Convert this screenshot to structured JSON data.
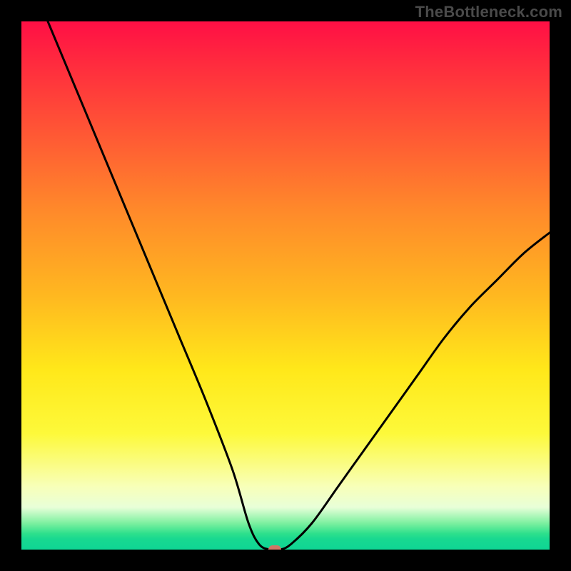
{
  "watermark": "TheBottleneck.com",
  "chart_data": {
    "type": "line",
    "title": "",
    "xlabel": "",
    "ylabel": "",
    "xlim": [
      0,
      100
    ],
    "ylim": [
      0,
      100
    ],
    "grid": false,
    "legend": false,
    "gradient_zones": [
      {
        "color": "#ff0f45",
        "position_pct": 0,
        "meaning": "severe-bottleneck"
      },
      {
        "color": "#ff8a2a",
        "position_pct": 36,
        "meaning": "high-bottleneck"
      },
      {
        "color": "#ffe81a",
        "position_pct": 66,
        "meaning": "moderate"
      },
      {
        "color": "#f8ffb8",
        "position_pct": 88,
        "meaning": "low"
      },
      {
        "color": "#18d890",
        "position_pct": 98,
        "meaning": "optimal"
      }
    ],
    "series": [
      {
        "name": "bottleneck-curve",
        "x": [
          5,
          10,
          15,
          20,
          25,
          30,
          35,
          40,
          43,
          45,
          47,
          49,
          51,
          55,
          60,
          65,
          70,
          75,
          80,
          85,
          90,
          95,
          100
        ],
        "y": [
          100,
          88,
          76,
          64,
          52,
          40,
          28,
          15,
          5,
          1,
          0,
          0,
          1,
          5,
          12,
          19,
          26,
          33,
          40,
          46,
          51,
          56,
          60
        ]
      }
    ],
    "optimal_point": {
      "x": 48,
      "y": 0
    },
    "marker_color": "#d07766"
  }
}
